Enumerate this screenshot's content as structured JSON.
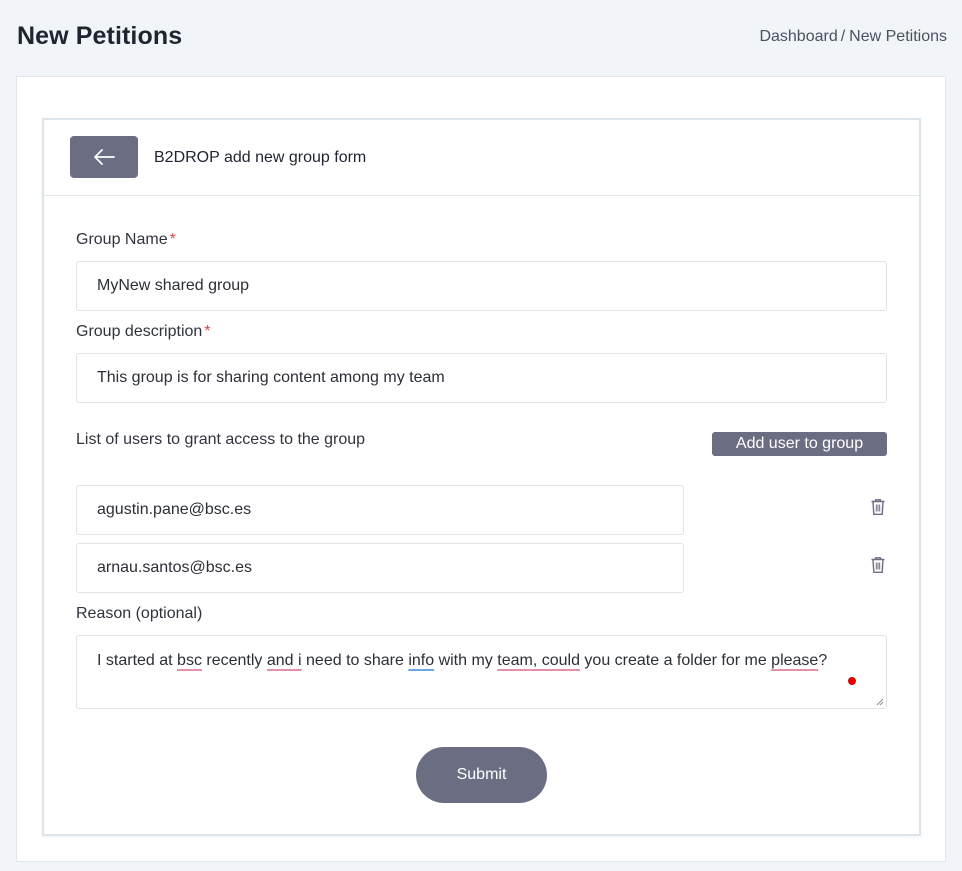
{
  "page": {
    "title": "New Petitions",
    "breadcrumb": {
      "items": [
        "Dashboard",
        "New Petitions"
      ],
      "separator": "/"
    }
  },
  "form": {
    "header_title": "B2DROP add new group form",
    "back_icon": "arrow-left-icon",
    "group_name": {
      "label": "Group Name",
      "required_mark": "*",
      "value": "MyNew shared group"
    },
    "group_description": {
      "label": "Group description",
      "required_mark": "*",
      "value": "This group is for sharing content among my team"
    },
    "users": {
      "label": "List of users to grant access to the group",
      "add_button_label": "Add user to group",
      "list": [
        "agustin.pane@bsc.es",
        "arnau.santos@bsc.es"
      ],
      "delete_icon": "trash-icon"
    },
    "reason": {
      "label": "Reason (optional)",
      "segments": [
        {
          "text": "I started at ",
          "mark": ""
        },
        {
          "text": "bsc",
          "mark": "red"
        },
        {
          "text": " recently ",
          "mark": ""
        },
        {
          "text": "and i",
          "mark": "red"
        },
        {
          "text": " need to share ",
          "mark": ""
        },
        {
          "text": "info",
          "mark": "blue"
        },
        {
          "text": " with my ",
          "mark": ""
        },
        {
          "text": "team, could",
          "mark": "red"
        },
        {
          "text": " you create a folder for me ",
          "mark": ""
        },
        {
          "text": "please",
          "mark": "red"
        },
        {
          "text": "?",
          "mark": ""
        }
      ]
    },
    "submit_label": "Submit"
  },
  "colors": {
    "button": "#6b6e82",
    "required": "#e5484d",
    "background": "#f1f4f8"
  }
}
